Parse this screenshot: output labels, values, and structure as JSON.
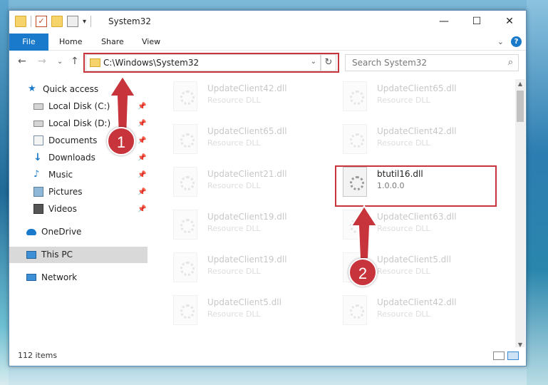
{
  "window": {
    "title": "System32",
    "controls": {
      "minimize": "—",
      "maximize": "☐",
      "close": "✕"
    }
  },
  "ribbon": {
    "tabs": [
      "File",
      "Home",
      "Share",
      "View"
    ]
  },
  "navigation": {
    "address": "C:\\Windows\\System32",
    "search_placeholder": "Search System32"
  },
  "sidebar": {
    "items": [
      {
        "label": "Quick access",
        "icon": "star-icon",
        "pinned": false
      },
      {
        "label": "Local Disk (C:)",
        "icon": "drive-icon",
        "pinned": true
      },
      {
        "label": "Local Disk (D:)",
        "icon": "drive-icon",
        "pinned": true
      },
      {
        "label": "Documents",
        "icon": "documents-icon",
        "pinned": true
      },
      {
        "label": "Downloads",
        "icon": "download-icon",
        "pinned": true
      },
      {
        "label": "Music",
        "icon": "music-icon",
        "pinned": true
      },
      {
        "label": "Pictures",
        "icon": "pictures-icon",
        "pinned": true
      },
      {
        "label": "Videos",
        "icon": "videos-icon",
        "pinned": true
      },
      {
        "label": "OneDrive",
        "icon": "cloud-icon",
        "pinned": false
      },
      {
        "label": "This PC",
        "icon": "computer-icon",
        "pinned": false,
        "selected": true
      },
      {
        "label": "Network",
        "icon": "network-icon",
        "pinned": false
      }
    ]
  },
  "files": [
    {
      "name": "UpdateClient42.dll",
      "desc": "Resource DLL",
      "faded": true
    },
    {
      "name": "UpdateClient65.dll",
      "desc": "Resource DLL",
      "faded": true
    },
    {
      "name": "UpdateClient65.dll",
      "desc": "Resource DLL",
      "faded": true
    },
    {
      "name": "UpdateClient42.dll",
      "desc": "Resource DLL",
      "faded": true
    },
    {
      "name": "UpdateClient21.dll",
      "desc": "Resource DLL",
      "faded": true
    },
    {
      "name": "btutil16.dll",
      "desc": "1.0.0.0",
      "faded": false,
      "highlighted": true
    },
    {
      "name": "UpdateClient19.dll",
      "desc": "Resource DLL",
      "faded": true
    },
    {
      "name": "UpdateClient63.dll",
      "desc": "Resource DLL",
      "faded": true
    },
    {
      "name": "UpdateClient19.dll",
      "desc": "Resource DLL",
      "faded": true
    },
    {
      "name": "UpdateClient5.dll",
      "desc": "Resource DLL",
      "faded": true
    },
    {
      "name": "UpdateClient5.dll",
      "desc": "Resource DLL",
      "faded": true
    },
    {
      "name": "UpdateClient42.dll",
      "desc": "Resource DLL",
      "faded": true
    }
  ],
  "status": {
    "item_count": "112 items"
  },
  "annotations": {
    "step1": "1",
    "step2": "2",
    "color": "#c8343c"
  }
}
